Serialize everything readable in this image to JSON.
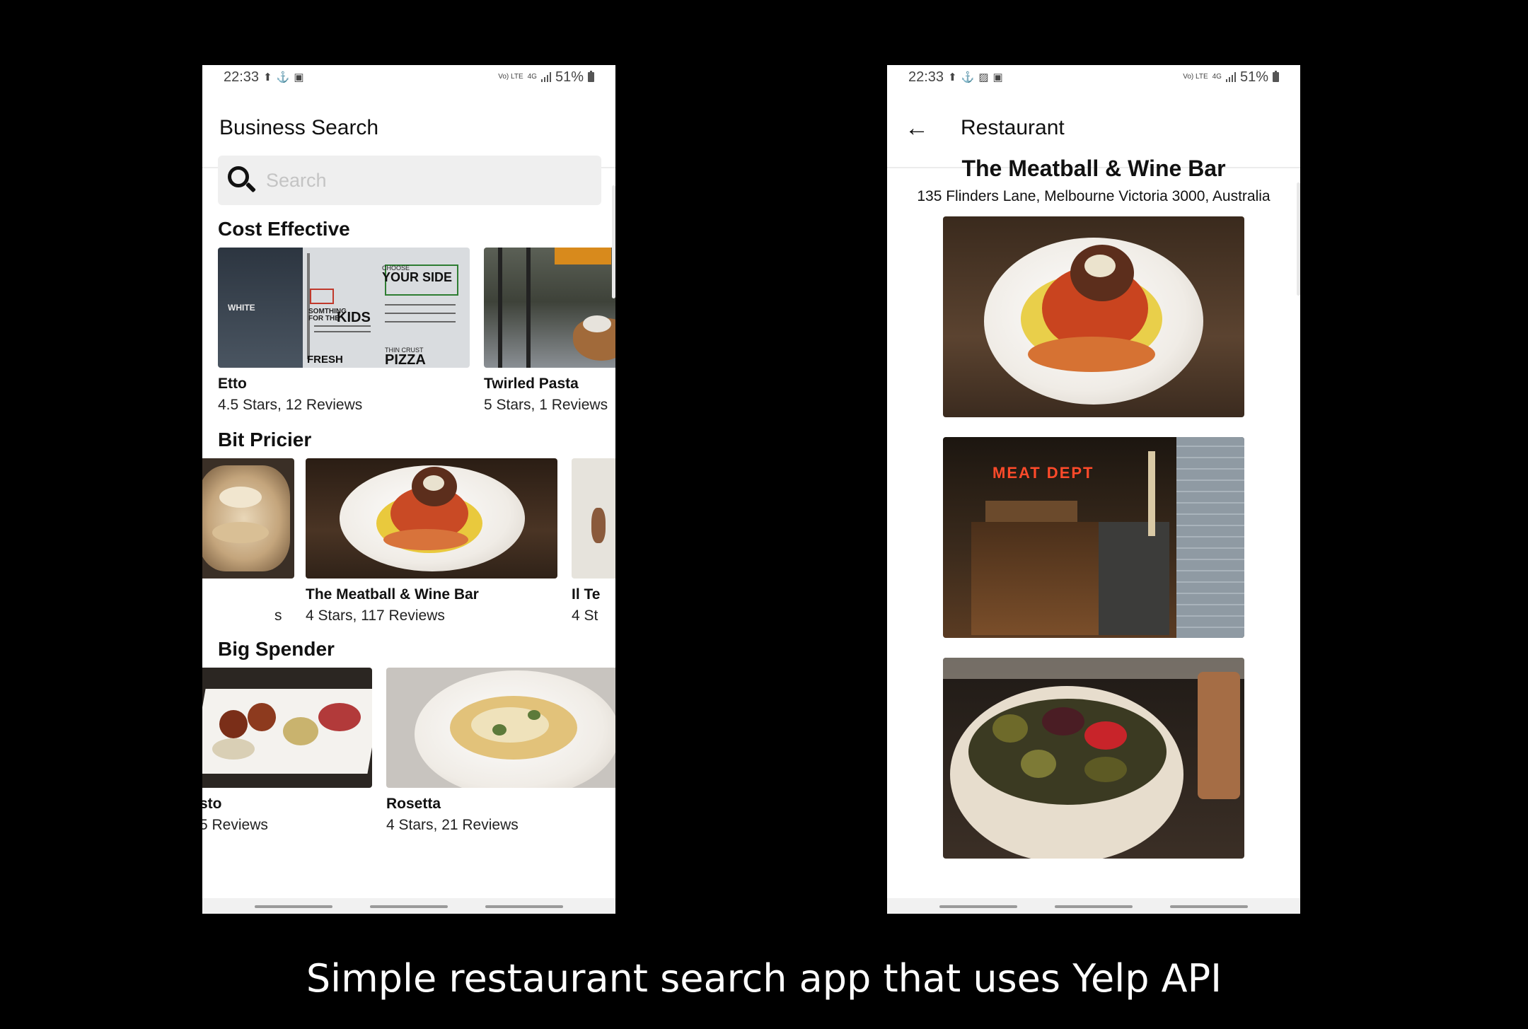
{
  "status_bar": {
    "left_time": "22:33",
    "right_time": "22:33",
    "network": "4G",
    "volte": "Vo) LTE",
    "battery": "51%"
  },
  "search_screen": {
    "title": "Business Search",
    "search": {
      "placeholder": "Search",
      "value": ""
    },
    "sections": [
      {
        "title": "Cost Effective",
        "cards": [
          {
            "name": "Etto",
            "meta": "4.5 Stars, 12 Reviews"
          },
          {
            "name": "Twirled Pasta",
            "meta": "5 Stars, 1 Reviews"
          }
        ]
      },
      {
        "title": "Bit Pricier",
        "cards": [
          {
            "name": "",
            "meta": "s"
          },
          {
            "name": "The Meatball & Wine Bar",
            "meta": "4 Stars, 117 Reviews"
          },
          {
            "name": "Il Te",
            "meta": "4 St"
          }
        ]
      },
      {
        "title": "Big Spender",
        "cards": [
          {
            "name": "sto",
            "meta": "5 Reviews"
          },
          {
            "name": "Rosetta",
            "meta": "4 Stars, 21 Reviews"
          }
        ]
      }
    ],
    "menu_text": {
      "side": "YOUR SIDE",
      "choose": "CHOOSE",
      "kids": "KIDS",
      "kids_prefix": "SOMTHING FOR THE",
      "white": "WHITE",
      "fresh": "FRESH",
      "pizza": "PIZZA",
      "thin": "THIN CRUST"
    }
  },
  "detail_screen": {
    "title": "Restaurant",
    "name": "The Meatball & Wine Bar",
    "address": "135 Flinders Lane, Melbourne Victoria 3000, Australia",
    "photo_sign": "MEAT DEPT"
  },
  "caption": "Simple restaurant search app that uses Yelp API",
  "icons": {
    "back": "arrow-left-icon",
    "search": "search-icon"
  },
  "colors": {
    "background": "#000000",
    "screen": "#ffffff",
    "search_field": "#efefef"
  }
}
